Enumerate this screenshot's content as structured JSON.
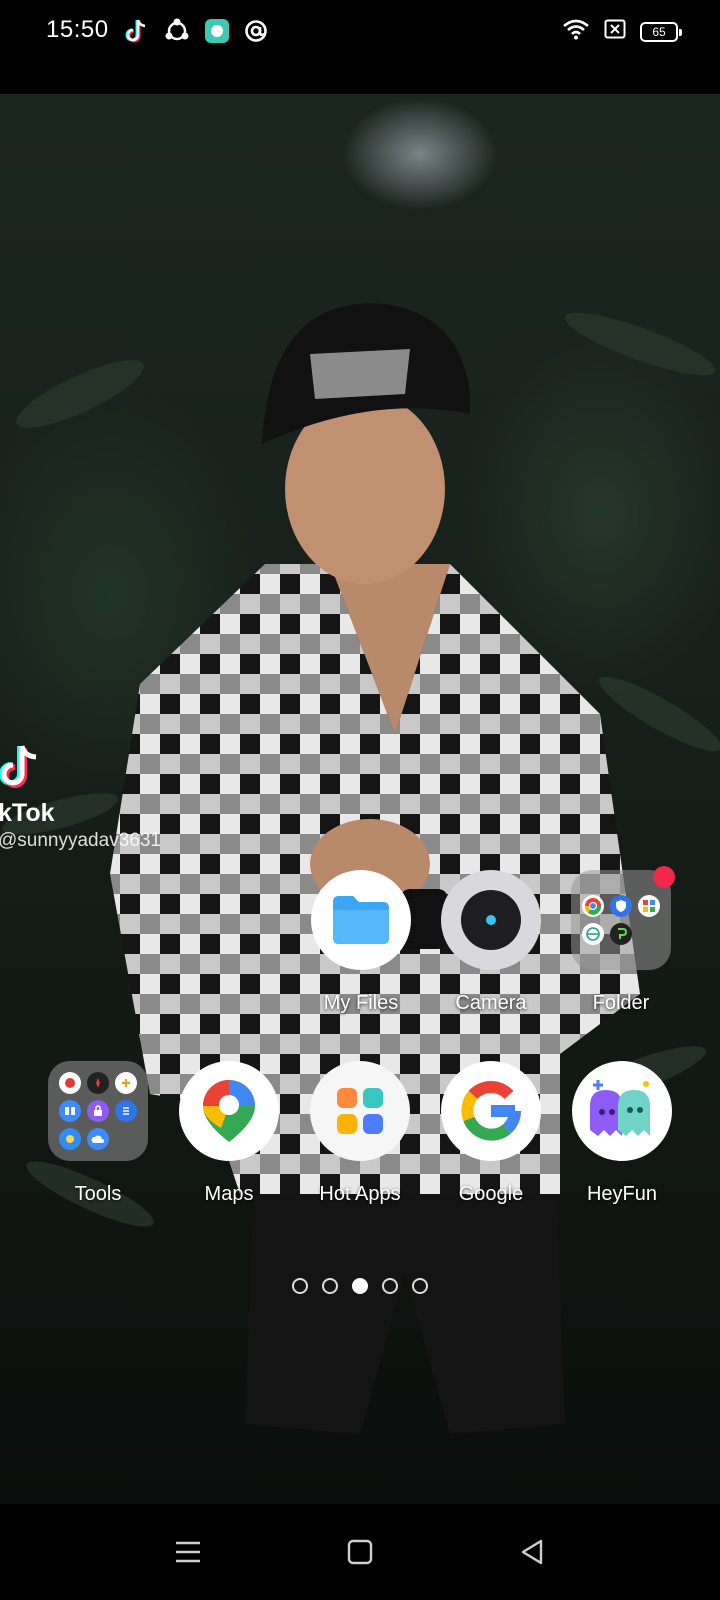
{
  "status_bar": {
    "time": "15:50",
    "notification_icons": [
      "tiktok-icon",
      "share-icon",
      "chat-app-icon",
      "at-sign-icon"
    ],
    "system_icons": [
      "wifi-icon",
      "sim-off-icon",
      "battery-icon"
    ],
    "battery_level": "65"
  },
  "tiktok_widget": {
    "name": "kTok",
    "username": "@sunnyyadav3631"
  },
  "apps": [
    {
      "id": "my-files",
      "label": "My Files"
    },
    {
      "id": "camera",
      "label": "Camera"
    },
    {
      "id": "folder",
      "label": "Folder",
      "has_badge": true
    },
    {
      "id": "tools",
      "label": "Tools"
    },
    {
      "id": "maps",
      "label": "Maps"
    },
    {
      "id": "hot-apps",
      "label": "Hot Apps"
    },
    {
      "id": "google",
      "label": "Google"
    },
    {
      "id": "heyfun",
      "label": "HeyFun"
    }
  ],
  "page_indicator": {
    "total": 5,
    "active": 3
  },
  "nav_bar": [
    "menu-icon",
    "home-icon",
    "back-icon"
  ],
  "colors": {
    "badge": "#f0294a",
    "files_blue": "#3aa6f5",
    "camera_dot": "#35c7f0"
  }
}
